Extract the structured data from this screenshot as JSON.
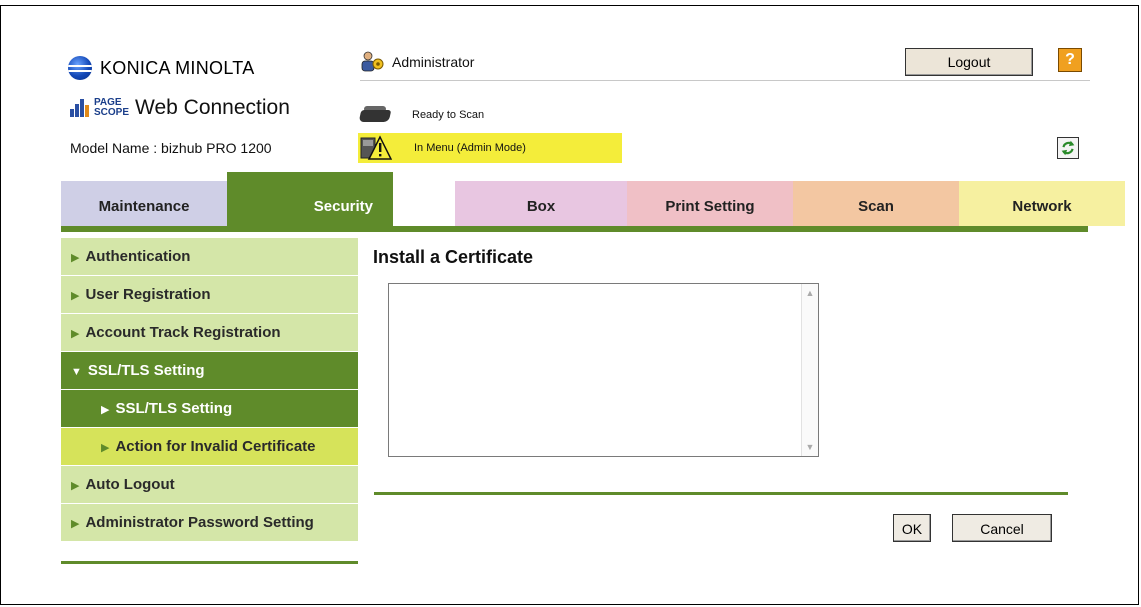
{
  "brand": {
    "company": "KONICA MINOLTA",
    "product_small_1": "PAGE",
    "product_small_2": "SCOPE",
    "product_name": "Web Connection",
    "model_name": "Model Name : bizhub PRO 1200"
  },
  "header": {
    "user": "Administrator",
    "logout_label": "Logout",
    "help_label": "?",
    "scan_status": "Ready to Scan",
    "mode_status": "In Menu (Admin Mode)",
    "status_color": "#f4ed3a"
  },
  "tabs": [
    {
      "label": "Maintenance",
      "color": "#cfcfe6"
    },
    {
      "label": "Security",
      "color": "#5f8b2a"
    },
    {
      "label": "Box",
      "color": "#e8c6e1"
    },
    {
      "label": "Print Setting",
      "color": "#f0c0c6"
    },
    {
      "label": "Scan",
      "color": "#f3c7a2"
    },
    {
      "label": "Network",
      "color": "#f6f0a0"
    }
  ],
  "sidebar": {
    "items": [
      {
        "label": "Authentication"
      },
      {
        "label": "User Registration"
      },
      {
        "label": "Account Track Registration"
      },
      {
        "label": "SSL/TLS Setting"
      },
      {
        "label": "SSL/TLS Setting"
      },
      {
        "label": "Action for Invalid Certificate"
      },
      {
        "label": "Auto Logout"
      },
      {
        "label": "Administrator Password Setting"
      }
    ]
  },
  "main": {
    "title": "Install a Certificate",
    "certificate_text": "",
    "ok_label": "OK",
    "cancel_label": "Cancel"
  },
  "icons": [
    "konica-minolta-logo-icon",
    "pagescope-icon",
    "administrator-icon",
    "scanner-icon",
    "warning-icon",
    "refresh-icon",
    "help-icon",
    "arrow-right-icon",
    "arrow-down-icon",
    "scroll-up-icon",
    "scroll-down-icon"
  ],
  "accent_color": "#5f8b2a"
}
